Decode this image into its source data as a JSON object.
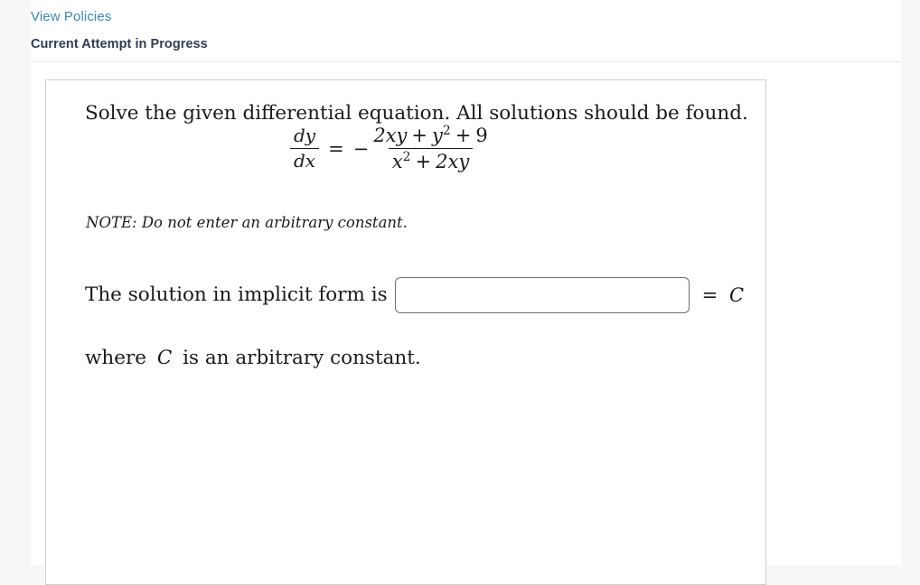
{
  "header": {
    "policies_link": "View Policies",
    "attempt_status": "Current Attempt in Progress"
  },
  "question": {
    "prompt": "Solve the given differential equation. All solutions should be found.",
    "equation": {
      "lhs_numerator": "dy",
      "lhs_denominator": "dx",
      "relation": "=",
      "sign": "−",
      "rhs_numerator_terms": [
        "2xy",
        "+",
        "y",
        "2",
        "+",
        "9"
      ],
      "rhs_numerator_plain": "2xy + y² + 9",
      "rhs_denominator_plain": "x² + 2xy",
      "rhs_num_a": "2xy",
      "rhs_num_plus1": "+",
      "rhs_num_y": "y",
      "rhs_num_y_exp": "2",
      "rhs_num_plus2": "+",
      "rhs_num_nine": "9",
      "rhs_den_x": "x",
      "rhs_den_x_exp": "2",
      "rhs_den_plus": "+",
      "rhs_den_2xy": "2xy"
    },
    "note": "NOTE: Do not enter an arbitrary constant.",
    "answer_label": "The solution in implicit form is",
    "answer_value": "",
    "answer_placeholder": "",
    "answer_suffix_eq": "=",
    "answer_suffix_c": "C",
    "closing_prefix": "where",
    "closing_constant": "C",
    "closing_suffix": "is an arbitrary constant."
  },
  "colors": {
    "link": "#3f87b3",
    "heading": "#2d3e50",
    "page_background": "#f7f7f7",
    "panel_background": "#ffffff",
    "card_border": "#cfcfcf",
    "input_border": "#6f6f6f",
    "divider": "#e8e8e8"
  }
}
